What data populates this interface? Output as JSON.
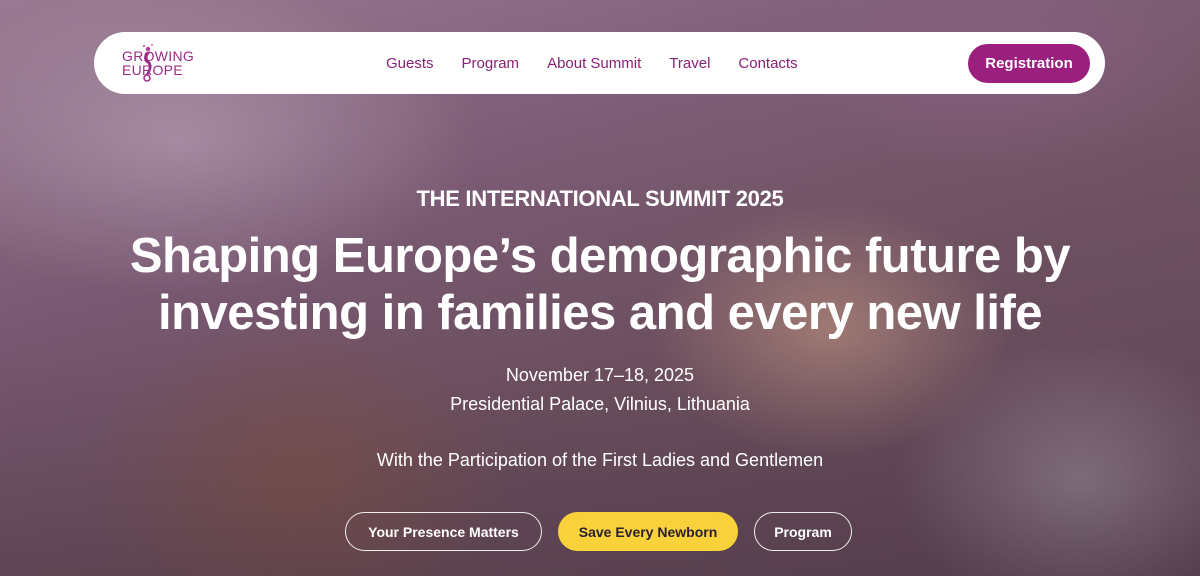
{
  "brand": {
    "logo_line1": "GROWING",
    "logo_line2": "EUROPE",
    "accent_color": "#9b1f7d",
    "highlight_color": "#f9d23b"
  },
  "nav": {
    "items": [
      {
        "label": "Guests"
      },
      {
        "label": "Program"
      },
      {
        "label": "About Summit"
      },
      {
        "label": "Travel"
      },
      {
        "label": "Contacts"
      }
    ],
    "register_label": "Registration"
  },
  "hero": {
    "eyebrow": "THE INTERNATIONAL SUMMIT 2025",
    "headline_line1": "Shaping Europe’s demographic future by",
    "headline_line2": "investing in families and every new life",
    "date": "November 17–18, 2025",
    "venue": "Presidential Palace, Vilnius, Lithuania",
    "participation": "With the Participation of the First Ladies and Gentlemen"
  },
  "cta": {
    "presence_label": "Your Presence Matters",
    "newborn_label": "Save Every Newborn",
    "program_label": "Program"
  }
}
